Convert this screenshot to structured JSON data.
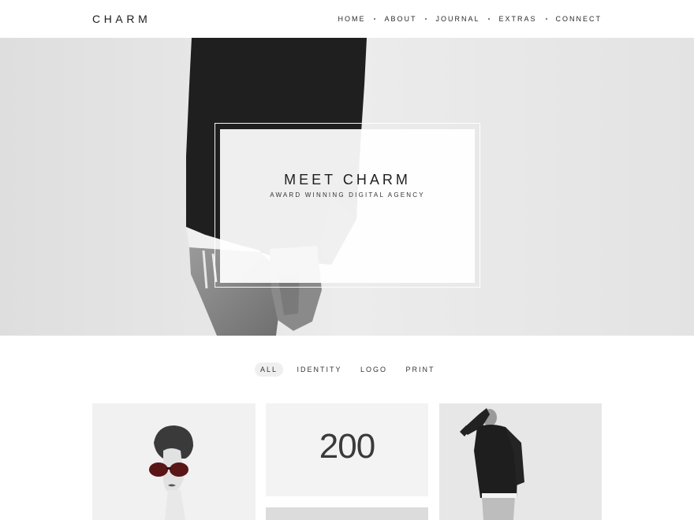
{
  "header": {
    "logo": "CHARM",
    "nav": [
      {
        "label": "HOME"
      },
      {
        "label": "ABOUT"
      },
      {
        "label": "JOURNAL"
      },
      {
        "label": "EXTRAS"
      },
      {
        "label": "CONNECT"
      }
    ]
  },
  "hero": {
    "title": "MEET CHARM",
    "subtitle": "AWARD WINNING DIGITAL AGENCY"
  },
  "filters": [
    {
      "label": "ALL",
      "active": true
    },
    {
      "label": "IDENTITY",
      "active": false
    },
    {
      "label": "LOGO",
      "active": false
    },
    {
      "label": "PRINT",
      "active": false
    }
  ],
  "portfolio": {
    "tile_number": "200"
  }
}
